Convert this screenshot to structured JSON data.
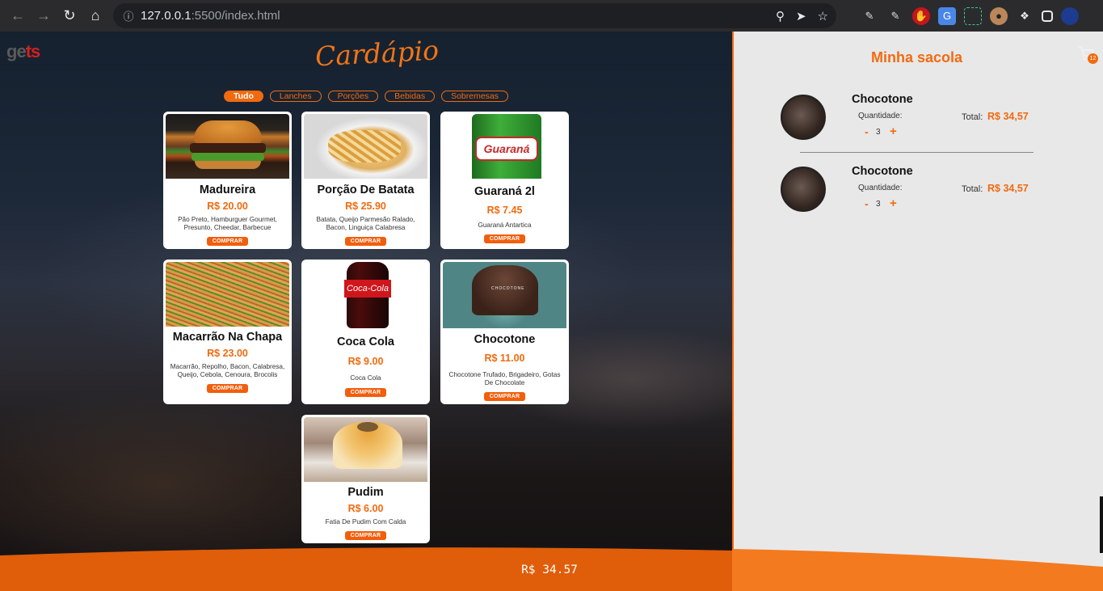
{
  "browser": {
    "url_host": "127.0.0.1",
    "url_path": ":5500/index.html"
  },
  "brand": {
    "logo_a": "ge",
    "logo_b": "ts",
    "title": "Cardápio"
  },
  "filters": [
    "Tudo",
    "Lanches",
    "Porções",
    "Bebidas",
    "Sobremesas"
  ],
  "products": [
    {
      "name": "Madureira",
      "price": "R$ 20.00",
      "desc": "Pão Preto, Hamburguer Gourmet, Presunto, Cheedar, Barbecue",
      "button": "COMPRAR",
      "image": "burger"
    },
    {
      "name": "Porção De Batata",
      "price": "R$ 25.90",
      "desc": "Batata, Queijo Parmesão Ralado, Bacon, Linguiça Calabresa",
      "button": "COMPRAR",
      "image": "fries"
    },
    {
      "name": "Guaraná 2l",
      "price": "R$ 7.45",
      "desc": "Guaraná Antartica",
      "button": "COMPRAR",
      "image": "guarana"
    },
    {
      "name": "Macarrão Na Chapa",
      "price": "R$ 23.00",
      "desc": "Macarrão, Repolho, Bacon, Calabresa, Queijo, Cebola, Cenoura, Brocolis",
      "button": "COMPRAR",
      "image": "noodles"
    },
    {
      "name": "Coca Cola",
      "price": "R$ 9.00",
      "desc": "Coca Cola",
      "button": "COMPRAR",
      "image": "coke"
    },
    {
      "name": "Chocotone",
      "price": "R$ 11.00",
      "desc": "Chocotone Trufado, Brigadeiro, Gotas De Chocolate",
      "button": "COMPRAR",
      "image": "chocotone"
    },
    {
      "name": "Pudim",
      "price": "R$ 6.00",
      "desc": "Fatia De Pudim Com Calda",
      "button": "COMPRAR",
      "image": "pudim"
    }
  ],
  "footer_total": "R$ 34.57",
  "sidebar": {
    "title": "Minha sacola",
    "cart_count": "12",
    "items": [
      {
        "name": "Chocotone",
        "qty_label": "Quantidade:",
        "minus": "-",
        "qty": "3",
        "plus": "+",
        "total_label": "Total:",
        "total": "R$ 34,57"
      },
      {
        "name": "Chocotone",
        "qty_label": "Quantidade:",
        "minus": "-",
        "qty": "3",
        "plus": "+",
        "total_label": "Total:",
        "total": "R$ 34,57"
      }
    ]
  },
  "colors": {
    "accent": "#f26a0f",
    "sidebar_bg": "#e8e8e8"
  }
}
